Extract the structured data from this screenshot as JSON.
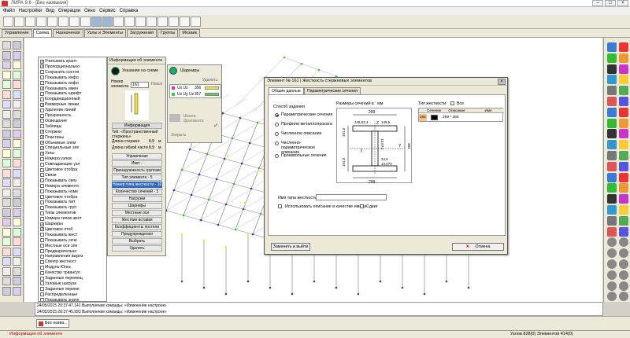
{
  "window": {
    "title": "ЛИРА 9.6 - [Без названия]"
  },
  "menu": [
    "Файл",
    "Настройки",
    "Вид",
    "Операции",
    "Окно",
    "Сервис",
    "Справка"
  ],
  "tabs": [
    {
      "label": "Управление",
      "active": false
    },
    {
      "label": "Схема",
      "active": true
    },
    {
      "label": "Назначения",
      "active": false
    },
    {
      "label": "Узлы и Элементы",
      "active": false
    },
    {
      "label": "Загружения",
      "active": false
    },
    {
      "label": "Группы",
      "active": false
    },
    {
      "label": "Мозаик",
      "active": false
    }
  ],
  "tree": [
    {
      "label": "Учитывать кранч",
      "checked": true
    },
    {
      "label": "Пропорционально",
      "checked": true
    },
    {
      "label": "Сохранить состоя",
      "checked": false
    },
    {
      "label": "Показывать инфо",
      "checked": false
    },
    {
      "label": "Показывать инфо",
      "checked": false
    },
    {
      "label": "Показывать имен",
      "checked": true
    },
    {
      "label": "Показывать шрифт",
      "checked": false
    },
    {
      "label": "Координационный",
      "checked": false
    },
    {
      "label": "Размерные линии",
      "checked": true
    },
    {
      "label": "Удаление линий",
      "checked": false
    },
    {
      "label": "Прозрачность",
      "checked": false
    },
    {
      "label": "Освещение",
      "checked": false
    },
    {
      "label": "Таблицы",
      "checked": false
    },
    {
      "label": "Стержни",
      "checked": true
    },
    {
      "label": "Пластины",
      "checked": true
    },
    {
      "label": "Объемные элем",
      "checked": true
    },
    {
      "label": "Специальные эле",
      "checked": true
    },
    {
      "label": "Узлы",
      "checked": true
    },
    {
      "label": "Номера узлов",
      "checked": false
    },
    {
      "label": "Совпадающие узл",
      "checked": false
    },
    {
      "label": "Цветовое отобра",
      "checked": false
    },
    {
      "label": "Связи",
      "checked": false
    },
    {
      "label": "Показывать связ",
      "checked": false
    },
    {
      "label": "Номера элементо",
      "checked": false
    },
    {
      "label": "Показывать номе",
      "checked": false
    },
    {
      "label": "Цветовое отобра",
      "checked": false
    },
    {
      "label": "Показывать тип",
      "checked": false
    },
    {
      "label": "Показывать груп",
      "checked": false
    },
    {
      "label": "Типы элементов",
      "checked": false
    },
    {
      "label": "Номера типов жест",
      "checked": false
    },
    {
      "label": "Шарниры",
      "checked": true
    },
    {
      "label": "Цветовое отоб",
      "checked": true
    },
    {
      "label": "Показывать жест",
      "checked": false
    },
    {
      "label": "Показывать сече",
      "checked": false
    },
    {
      "label": "Местные оси эле",
      "checked": false
    },
    {
      "label": "Предварительно",
      "checked": false
    },
    {
      "label": "Направления вырез",
      "checked": false
    },
    {
      "label": "Спектр жесткост",
      "checked": false
    },
    {
      "label": "Модуль Юнга",
      "checked": false
    },
    {
      "label": "Качество триангул",
      "checked": false
    },
    {
      "label": "Заданные перемещ",
      "checked": false
    },
    {
      "label": "Узловые нагрузк",
      "checked": false
    },
    {
      "label": "Заданные переме",
      "checked": false
    },
    {
      "label": "Распределенные",
      "checked": false
    },
    {
      "label": "Показывать значе",
      "checked": false
    }
  ],
  "info_panel": {
    "title": "Информация об элементе",
    "pick_label": "Указание на схеме",
    "number_label": "Номер элемента",
    "number_value": "161",
    "search_label": "Поиск",
    "info_header": "Информация",
    "type_text": "Тип: «Пространственный стержень»",
    "length_label": "Длина стержня",
    "length_value": "8,9",
    "length_unit": "м",
    "flex_label": "Длина гибкой части",
    "flex_value": "8,9",
    "flex_unit": "м",
    "buttons": [
      {
        "label": "Управление",
        "hl": false
      },
      {
        "label": "Имя: -",
        "hl": false
      },
      {
        "label": "Принадлежность группам",
        "hl": false
      },
      {
        "label": "Тип элемента - 5",
        "hl": false
      },
      {
        "label": "Номер типа жесткости - 161",
        "hl": true
      },
      {
        "label": "Количество сечений - 3",
        "hl": false
      },
      {
        "label": "Нагрузки",
        "hl": false
      },
      {
        "label": "Шарниры",
        "hl": false
      },
      {
        "label": "Местные оси",
        "hl": false
      },
      {
        "label": "Жесткие вставки",
        "hl": false
      },
      {
        "label": "Коэффициенты постели",
        "hl": false
      },
      {
        "label": "Предупреждения",
        "hl": false
      },
      {
        "label": "Выбрать",
        "hl": false
      },
      {
        "label": "Удалить",
        "hl": false
      }
    ]
  },
  "hinge_panel": {
    "title": "Шарниры",
    "delete_label": "Удалить",
    "row1": "Ux Uz",
    "row1_val": "356",
    "row2": "Ux Uy Uz",
    "row2_val": "357",
    "scale_label": "Шкала фрагмента",
    "close_label": "Закрыть"
  },
  "dialog": {
    "title": "Элемент № 161 | Жесткость стержневых элементов",
    "tabs": [
      "Общие данные",
      "Параметрические сечения"
    ],
    "group_label": "Способ задания",
    "options": [
      {
        "label": "Параметрические сечения",
        "on": true
      },
      {
        "label": "Профили металлопроката",
        "on": false
      },
      {
        "label": "Численное описание",
        "on": false
      },
      {
        "label": "Численно-параметрическое описание",
        "on": false
      },
      {
        "label": "Произвольные сечения",
        "on": false
      }
    ],
    "section_size_label": "Размеры сечений в : мм",
    "dims": {
      "top": "299",
      "left_flange": "148,52,4",
      "right_flange": "149,5",
      "web": "13,074",
      "height_left1": "191,5",
      "height_left2": "191,5",
      "height_right": "383",
      "bottom_flange": "34,6",
      "bottom_web": "13,074",
      "bottom": "299",
      "axis_y": "Y",
      "axis_z": "Z",
      "section_label": "I"
    },
    "stiffness_type_label": "Тип жесткости",
    "all_label": "Все",
    "table_headers": [
      "",
      "Сечение",
      "Описание",
      "Имя"
    ],
    "table_row": {
      "num": "161",
      "desc": "299 * 383",
      "name": ""
    },
    "name_label": "Имя типа жесткости",
    "use_desc_label": "Использовать описание в качестве имени",
    "shift_label": "Сдвиг",
    "replace_btn": "Заменить и выйти",
    "cancel_btn": "Отмена"
  },
  "log": [
    "24/05/2015 20:37:47.141 Выполнение команды: «Изменение настроек»",
    "24/05/2015 20:37:45.993 Выполнение команды: «Изменение настроек»"
  ],
  "taskbar": {
    "doc": "Без назва..."
  },
  "status": {
    "left": "Информация об элементе",
    "right": "Узлов 828(0)  Элементов 414(0)"
  }
}
